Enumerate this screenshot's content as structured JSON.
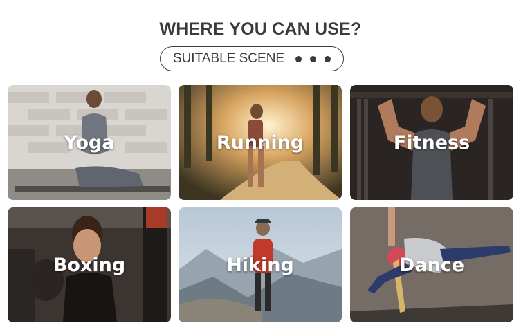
{
  "header": {
    "title": "WHERE YOU CAN USE?",
    "badge": "SUITABLE SCENE"
  },
  "scenes": [
    {
      "label": "Yoga"
    },
    {
      "label": "Running"
    },
    {
      "label": "Fitness"
    },
    {
      "label": "Boxing"
    },
    {
      "label": "Hiking"
    },
    {
      "label": "Dance"
    }
  ],
  "colors": {
    "text": "#3b3b3b",
    "label": "#ffffff"
  }
}
